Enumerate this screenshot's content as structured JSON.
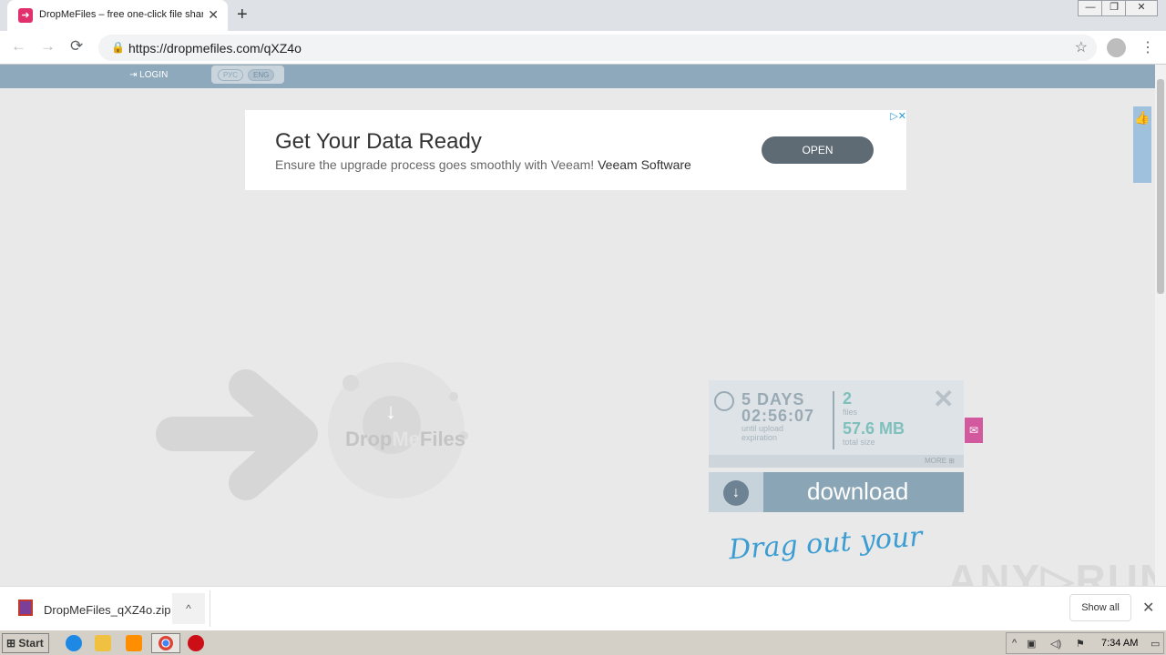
{
  "browser": {
    "tab_title": "DropMeFiles – free one-click file sharing",
    "tab_close": "✕",
    "new_tab": "+",
    "window_buttons": {
      "minimize": "—",
      "restore": "❐",
      "close": "✕"
    },
    "nav": {
      "back": "←",
      "forward": "→",
      "reload": "⟳",
      "menu": "⋮"
    },
    "url": "https://dropmefiles.com/qXZ4o",
    "star": "☆"
  },
  "site": {
    "login": "LOGIN",
    "lang_ru": "РУС",
    "lang_en": "ENG",
    "ad": {
      "title": "Get Your Data Ready",
      "desc": "Ensure the upgrade process goes smoothly with Veeam!",
      "sponsor": "Veeam Software",
      "button": "OPEN",
      "ad_icons": "▷✕"
    },
    "logo": {
      "drop": "Drop",
      "me": "Me",
      "files": "Files",
      "arrow": "↓"
    },
    "panel": {
      "days": "5 DAYS",
      "time": "02:56:07",
      "until_label": "until upload expiration",
      "files_count": "2",
      "files_label": "files",
      "total_size": "57.6 MB",
      "total_label": "total size",
      "more": "MORE",
      "close": "✕"
    },
    "download": {
      "label": "download",
      "icon": "↓"
    },
    "drag_text": "Drag out your",
    "like": "👍",
    "feedback": "✉"
  },
  "watermark": "ANY▷RUN",
  "shelf": {
    "file_name": "DropMeFiles_qXZ4o.zip",
    "chevron": "^",
    "show_all": "Show all",
    "close": "✕"
  },
  "taskbar": {
    "start": "Start",
    "time": "7:34 AM",
    "tray_arrow": "^"
  }
}
